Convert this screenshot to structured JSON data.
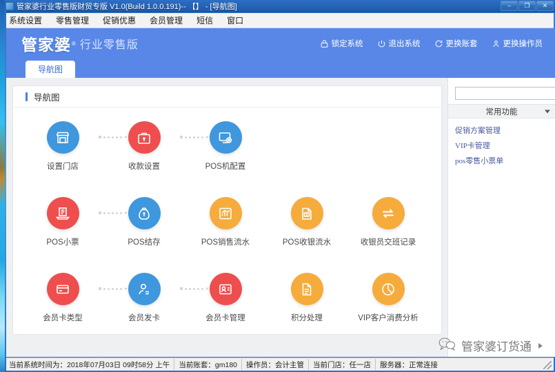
{
  "window": {
    "title": "管家婆行业零售版财贸专版 V1.0(Build 1.0.0.191)-- 【】 - [导航图]",
    "minimize": "–",
    "maximize": "❐",
    "close": "✕"
  },
  "menubar": {
    "items": [
      {
        "label": "系统设置"
      },
      {
        "label": "零售管理"
      },
      {
        "label": "促销优惠"
      },
      {
        "label": "会员管理"
      },
      {
        "label": "短信"
      },
      {
        "label": "窗口"
      }
    ]
  },
  "header": {
    "logo_main": "管家婆",
    "logo_reg": "®",
    "logo_sub": "行业零售版",
    "actions": [
      {
        "label": "锁定系统",
        "icon": "lock-icon"
      },
      {
        "label": "退出系统",
        "icon": "power-icon"
      },
      {
        "label": "更换账套",
        "icon": "refresh-icon"
      },
      {
        "label": "更换操作员",
        "icon": "user-icon"
      }
    ]
  },
  "tabs": [
    {
      "label": "导航图",
      "active": true
    }
  ],
  "card": {
    "title": "导航图"
  },
  "nav_rows": [
    {
      "nodes": [
        {
          "label": "设置门店",
          "color": "#3f97de",
          "icon": "store-icon"
        },
        {
          "label": "收款设置",
          "color": "#ef4e4e",
          "icon": "cashbox-icon"
        },
        {
          "label": "POS机配置",
          "color": "#3f97de",
          "icon": "monitor-gear-icon"
        }
      ]
    },
    {
      "nodes": [
        {
          "label": "POS小票",
          "color": "#ef4e4e",
          "icon": "receipt-icon"
        },
        {
          "label": "POS结存",
          "color": "#3f97de",
          "icon": "moneybag-icon"
        },
        {
          "label": "POS销售流水",
          "color": "#f5ac3c",
          "icon": "chart-icon"
        },
        {
          "label": "POS收银流水",
          "color": "#f5ac3c",
          "icon": "cash-doc-icon"
        },
        {
          "label": "收银员交班记录",
          "color": "#f5ac3c",
          "icon": "exchange-icon"
        }
      ]
    },
    {
      "nodes": [
        {
          "label": "会员卡类型",
          "color": "#ef4e4e",
          "icon": "card-icon"
        },
        {
          "label": "会员发卡",
          "color": "#3f97de",
          "icon": "user-card-icon"
        },
        {
          "label": "会员卡管理",
          "color": "#ef4e4e",
          "icon": "id-card-icon"
        },
        {
          "label": "积分处理",
          "color": "#f5ac3c",
          "icon": "document-icon"
        },
        {
          "label": "VIP客户消费分析",
          "color": "#f5ac3c",
          "icon": "pie-chart-icon"
        }
      ]
    }
  ],
  "sidebar": {
    "search_value": "",
    "search_placeholder": "",
    "search_icon": "search-icon",
    "settings_icon": "gear-icon",
    "panel_title": "常用功能",
    "links": [
      {
        "label": "促销方案管理"
      },
      {
        "label": "VIP卡管理"
      },
      {
        "label": "pos零售小票单"
      }
    ]
  },
  "watermark": {
    "text": "管家婆订货通",
    "icon": "chat-bubble-icon"
  },
  "statusbar": {
    "cells": [
      {
        "label": "当前系统时间为：2018年07月03日 09时58分 上午"
      },
      {
        "label": "当前账套：gm180"
      },
      {
        "label": "操作员：会计主管"
      },
      {
        "label": "当前门店：任一店"
      },
      {
        "label": "服务器：正常连接"
      }
    ]
  },
  "colors": {
    "brand_blue": "#5887e8",
    "icon_blue": "#3f97de",
    "icon_red": "#ef4e4e",
    "icon_orange": "#f5ac3c",
    "link": "#4a5a9e"
  }
}
